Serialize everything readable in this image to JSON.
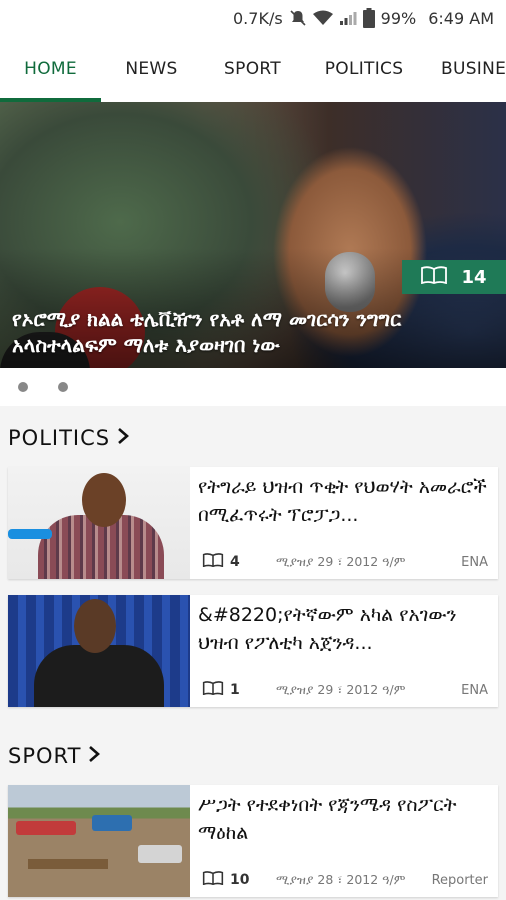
{
  "status_bar": {
    "speed": "0.7K/s",
    "battery": "99%",
    "time": "6:49 AM"
  },
  "tabs": [
    {
      "label": "HOME",
      "active": true
    },
    {
      "label": "NEWS",
      "active": false
    },
    {
      "label": "SPORT",
      "active": false
    },
    {
      "label": "POLITICS",
      "active": false
    },
    {
      "label": "BUSINE",
      "active": false
    }
  ],
  "hero": {
    "title": "የኦሮሚያ ክልል ቴሌቪዥን የአቶ ለማ መገርሳን ንግግር አላስተላልፍም ማለቱ እያወዛገበ ነው",
    "read_count": "14"
  },
  "sections": [
    {
      "title": "POLITICS",
      "articles": [
        {
          "title": "የትግራይ ህዝብ ጥቂት የህወሃት አመራሮች በሚፈጥሩት ፕሮፓጋ...",
          "count": "4",
          "date": "ሚያዝያ 29 ፣ 2012 ዓ/ም",
          "source": "ENA"
        },
        {
          "title": "&#8220;የትኛውም አካል የአገውን ህዝብ የፖለቲካ አጀንዳ...",
          "count": "1",
          "date": "ሚያዝያ 29 ፣ 2012 ዓ/ም",
          "source": "ENA"
        }
      ]
    },
    {
      "title": "SPORT",
      "articles": [
        {
          "title": "ሥጋት የተደቀነበት የጃንሜዳ የስፖርት ማዕከል",
          "count": "10",
          "date": "ሚያዝያ 28 ፣ 2012 ዓ/ም",
          "source": "Reporter"
        }
      ]
    }
  ],
  "colors": {
    "accent": "#106b3c",
    "badge": "#1f7a57"
  }
}
